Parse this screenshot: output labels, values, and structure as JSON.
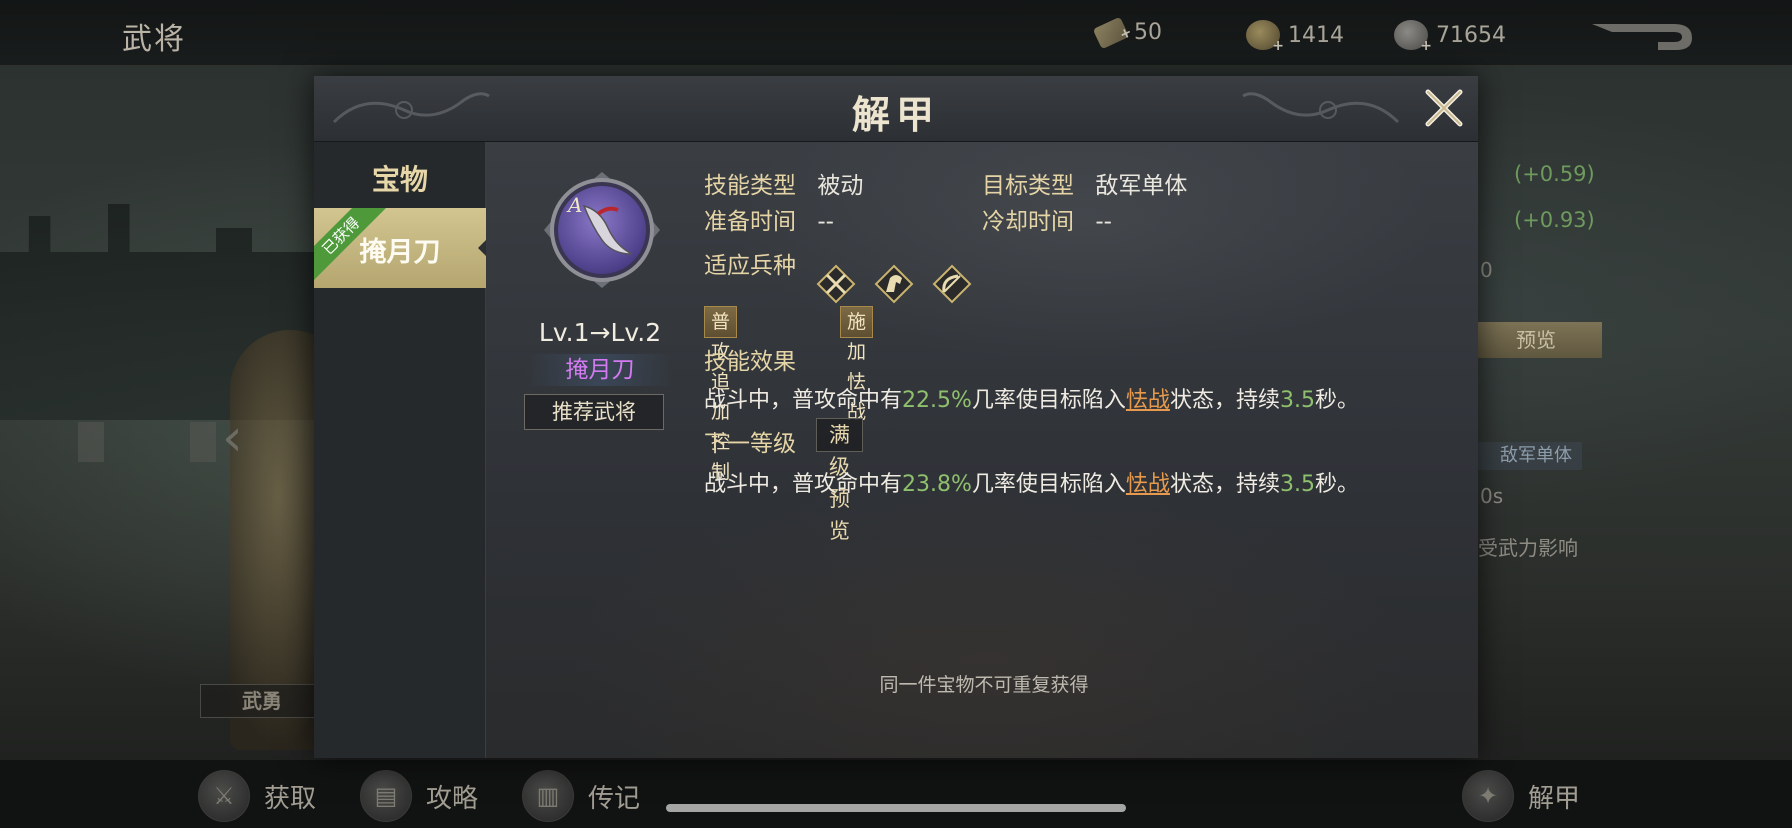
{
  "topbar": {
    "title": "武将",
    "resources": [
      {
        "icon": "ticket-icon",
        "value": "50"
      },
      {
        "icon": "gold-coin-icon",
        "value": "1414"
      },
      {
        "icon": "silver-coin-icon",
        "value": "71654"
      }
    ]
  },
  "background_panel": {
    "stat1": "(+0.59)",
    "stat2": "(+0.93)",
    "stat3": "0",
    "preview_button": "预览",
    "target_tag": "敌军单体",
    "duration_frag": "0s",
    "note_frag": "受武力影响",
    "wuyong_label": "武勇"
  },
  "bottombar": {
    "items": [
      {
        "label": "获取",
        "icon": "obtain-icon"
      },
      {
        "label": "攻略",
        "icon": "guide-icon"
      },
      {
        "label": "传记",
        "icon": "biography-icon"
      },
      {
        "label": "解甲",
        "icon": "unarmor-icon"
      }
    ]
  },
  "modal": {
    "title": "解甲",
    "sidebar": {
      "heading": "宝物",
      "items": [
        {
          "label": "掩月刀",
          "ribbon": "已获得"
        }
      ]
    },
    "item": {
      "grade": "A",
      "level_text": "Lv.1→Lv.2",
      "name": "掩月刀",
      "recommend_button": "推荐武将"
    },
    "skill": {
      "type_label": "技能类型",
      "type_value": "被动",
      "target_label": "目标类型",
      "target_value": "敌军单体",
      "prep_label": "准备时间",
      "prep_value": "--",
      "cooldown_label": "冷却时间",
      "cooldown_value": "--",
      "troop_label": "适应兵种",
      "troops": [
        "spear-icon",
        "cavalry-icon",
        "archer-icon"
      ],
      "tags": [
        "普攻追加控制",
        "施加怯战"
      ],
      "effect_label": "技能效果",
      "effect": {
        "prefix": "战斗中，普攻命中有",
        "chance": "22.5%",
        "mid": "几率使目标陷入",
        "status": "怯战",
        "mid2": "状态，持续",
        "duration": "3.5",
        "suffix": "秒。"
      },
      "next_label": "下一等级",
      "max_preview_button": "满级预览",
      "next_effect": {
        "prefix": "战斗中，普攻命中有",
        "chance": "23.8%",
        "mid": "几率使目标陷入",
        "status": "怯战",
        "mid2": "状态，持续",
        "duration": "3.5",
        "suffix": "秒。"
      }
    },
    "note": "同一件宝物不可重复获得"
  }
}
